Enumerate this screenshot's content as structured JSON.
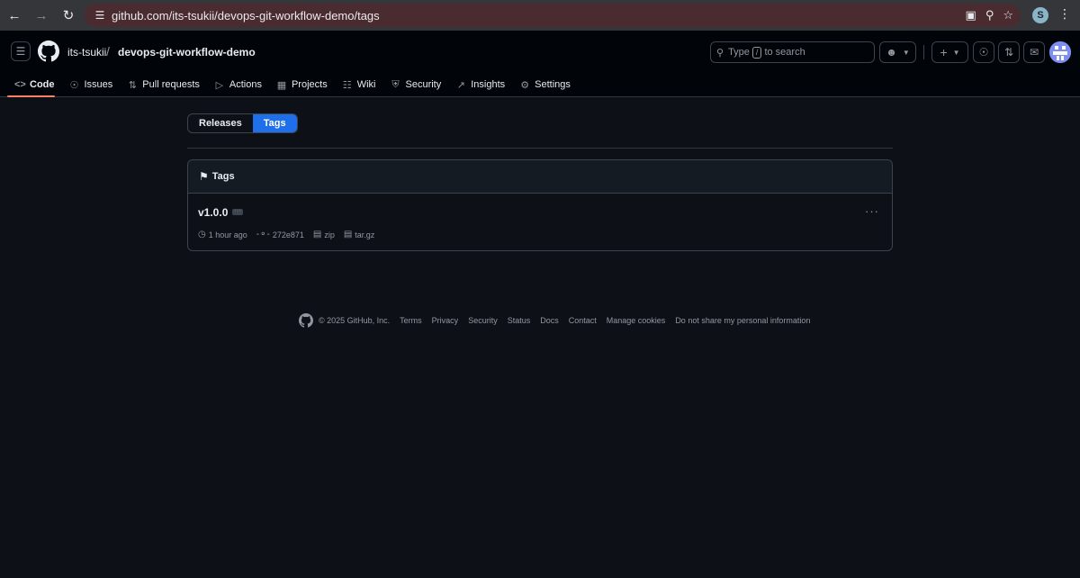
{
  "browser": {
    "url": "github.com/its-tsukii/devops-git-workflow-demo/tags",
    "profile_initial": "S"
  },
  "header": {
    "owner": "its-tsukii",
    "separator": "/",
    "repo": "devops-git-workflow-demo",
    "search_prefix": "Type",
    "search_key": "/",
    "search_suffix": "to search"
  },
  "repo_tabs": [
    {
      "label": "Code",
      "icon": "code-icon"
    },
    {
      "label": "Issues",
      "icon": "issue-icon"
    },
    {
      "label": "Pull requests",
      "icon": "pull-request-icon"
    },
    {
      "label": "Actions",
      "icon": "play-icon"
    },
    {
      "label": "Projects",
      "icon": "table-icon"
    },
    {
      "label": "Wiki",
      "icon": "book-icon"
    },
    {
      "label": "Security",
      "icon": "shield-icon"
    },
    {
      "label": "Insights",
      "icon": "graph-icon"
    },
    {
      "label": "Settings",
      "icon": "gear-icon"
    }
  ],
  "subnav": {
    "releases": "Releases",
    "tags": "Tags"
  },
  "tags_box": {
    "title": "Tags",
    "items": [
      {
        "name": "v1.0.0",
        "time": "1 hour ago",
        "commit": "272e871",
        "zip": "zip",
        "targz": "tar.gz"
      }
    ]
  },
  "footer": {
    "copyright": "© 2025 GitHub, Inc.",
    "links": [
      "Terms",
      "Privacy",
      "Security",
      "Status",
      "Docs",
      "Contact",
      "Manage cookies",
      "Do not share my personal information"
    ]
  }
}
